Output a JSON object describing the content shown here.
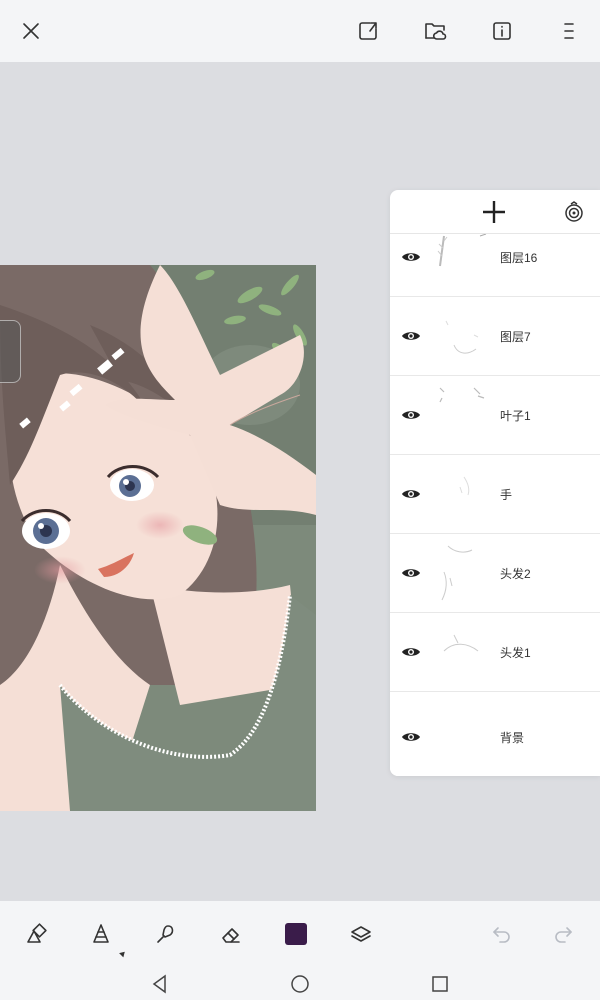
{
  "topbar": {
    "icons": [
      "close-icon",
      "share-icon",
      "cloud-folder-icon",
      "info-icon",
      "menu-icon"
    ]
  },
  "layers_panel": {
    "icons": [
      "add-layer-icon",
      "blend-mode-icon",
      "eye-icon"
    ],
    "layers": [
      {
        "name": "图层16"
      },
      {
        "name": "图层7"
      },
      {
        "name": "叶子1"
      },
      {
        "name": "手"
      },
      {
        "name": "头发2"
      },
      {
        "name": "头发1"
      }
    ],
    "background": {
      "name": "背景"
    }
  },
  "bottombar": {
    "tools": [
      "shapes-icon",
      "brush-icon",
      "smudge-icon",
      "eraser-icon",
      "color-swatch",
      "layers-icon",
      "undo-icon",
      "redo-icon"
    ],
    "current_color": "#3a1c4a"
  },
  "sysnav": {
    "icons": [
      "back-icon",
      "home-icon",
      "recents-icon"
    ]
  },
  "colors": {
    "accent": "#3a1c4a",
    "panel_bg": "#ffffff",
    "workspace_bg": "#dcdde1"
  }
}
